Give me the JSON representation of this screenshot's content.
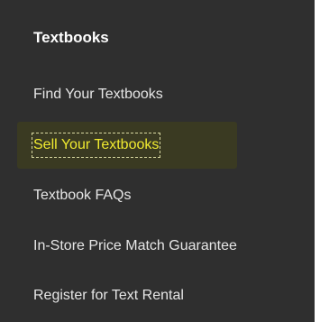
{
  "menu": {
    "heading": "Textbooks",
    "items": [
      {
        "label": "Find Your Textbooks"
      },
      {
        "label": "Sell Your Textbooks",
        "active": true
      },
      {
        "label": "Textbook FAQs"
      },
      {
        "label": "In-Store Price Match Guarantee"
      },
      {
        "label": "Register for Text Rental"
      }
    ]
  },
  "colors": {
    "panel_background": "#2f2f2f",
    "text": "#e6e6e6",
    "heading": "#ffffff",
    "active_text": "#f0ea30",
    "active_background": "#3a3a22"
  }
}
